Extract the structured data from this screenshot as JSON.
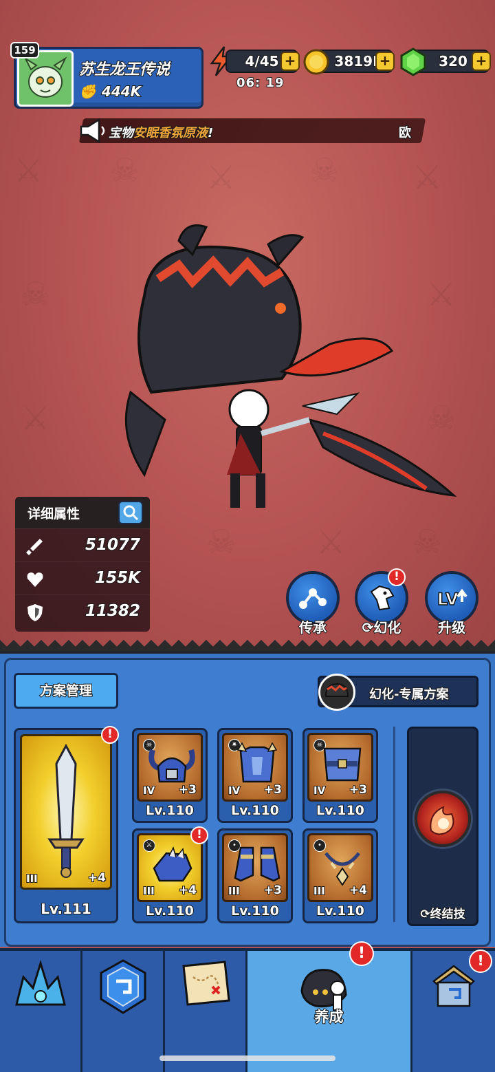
{
  "player": {
    "level": "159",
    "name": "苏生龙王传说",
    "power": "444K"
  },
  "resources": {
    "energy": "4/45",
    "energy_timer": "06: 19",
    "gold": "3819K",
    "gems": "320"
  },
  "announcement": {
    "prefix": "宝物",
    "highlight": "安眠香氛原液",
    "suffix": "!",
    "trailing": "欧"
  },
  "stats": {
    "title": "详细属性",
    "attack": "51077",
    "hp": "155K",
    "defense": "11382"
  },
  "actions": {
    "inherit": "传承",
    "transform": "幻化",
    "upgrade": "升级",
    "alert": "!"
  },
  "equipment": {
    "plan_button": "方案管理",
    "exclusive_plan": "幻化-专属方案",
    "weapon": {
      "tier": "III",
      "plus": "+4",
      "level": "Lv.111"
    },
    "gear": [
      {
        "slot": "helmet",
        "tier": "IV",
        "plus": "+3",
        "level": "Lv.110"
      },
      {
        "slot": "armor",
        "tier": "IV",
        "plus": "+3",
        "level": "Lv.110"
      },
      {
        "slot": "chest",
        "tier": "IV",
        "plus": "+3",
        "level": "Lv.110"
      },
      {
        "slot": "gloves",
        "tier": "III",
        "plus": "+4",
        "level": "Lv.110"
      },
      {
        "slot": "boots",
        "tier": "III",
        "plus": "+3",
        "level": "Lv.110"
      },
      {
        "slot": "necklace",
        "tier": "III",
        "plus": "+4",
        "level": "Lv.110"
      }
    ],
    "finisher": "终结技"
  },
  "nav": {
    "active_label": "养成"
  },
  "colors": {
    "accent_blue": "#3a76c8",
    "gold": "#f3c92f",
    "alert_red": "#e32828"
  }
}
